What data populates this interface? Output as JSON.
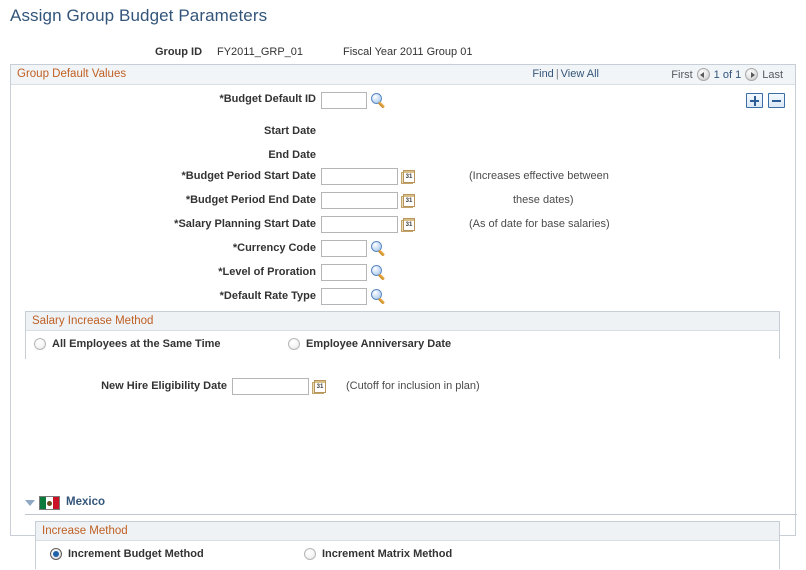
{
  "page": {
    "title": "Assign Group Budget Parameters"
  },
  "keys": {
    "group_id_label": "Group ID",
    "group_id_value": "FY2011_GRP_01",
    "group_desc_value": "Fiscal Year 2011 Group 01"
  },
  "group_default_values": {
    "header": "Group Default Values",
    "nav": {
      "find": "Find",
      "separator": "|",
      "view_all": "View All",
      "first": "First",
      "counter": "1 of 1",
      "last": "Last",
      "prev_icon": "prev-arrow-icon",
      "next_icon": "next-arrow-icon"
    },
    "row_actions": {
      "add_label": "+",
      "delete_label": "-"
    },
    "fields": [
      {
        "label": "*Budget Default ID",
        "value": "",
        "control": "lookup"
      },
      {
        "label": "Start Date",
        "value": "",
        "control": "display"
      },
      {
        "label": "End Date",
        "value": "",
        "control": "display"
      },
      {
        "label": "*Budget Period Start Date",
        "value": "",
        "control": "date"
      },
      {
        "label": "*Budget Period End Date",
        "value": "",
        "control": "date"
      },
      {
        "label": "*Salary Planning Start Date",
        "value": "",
        "control": "date"
      },
      {
        "label": "*Currency Code",
        "value": "",
        "control": "lookup"
      },
      {
        "label": "*Level of Proration",
        "value": "",
        "control": "lookup"
      },
      {
        "label": "*Default Rate Type",
        "value": "",
        "control": "lookup"
      }
    ],
    "hints": {
      "increases_line1": "(Increases effective between",
      "increases_line2": "these dates)",
      "salary_planning": "(As of date for base salaries)",
      "new_hire": "(Cutoff for inclusion in plan)"
    }
  },
  "salary_increase_method": {
    "header": "Salary Increase Method",
    "options": [
      {
        "label": "All Employees at the Same Time",
        "selected": false
      },
      {
        "label": "Employee Anniversary Date",
        "selected": false
      }
    ]
  },
  "new_hire": {
    "label": "New Hire Eligibility Date",
    "value": ""
  },
  "country_section": {
    "expander_icon": "collapse-triangle-icon",
    "flag_icon": "mexico-flag-icon",
    "name": "Mexico"
  },
  "increase_method": {
    "header": "Increase Method",
    "options": [
      {
        "label": "Increment Budget Method",
        "selected": true
      },
      {
        "label": "Increment Matrix Method",
        "selected": false
      }
    ]
  }
}
